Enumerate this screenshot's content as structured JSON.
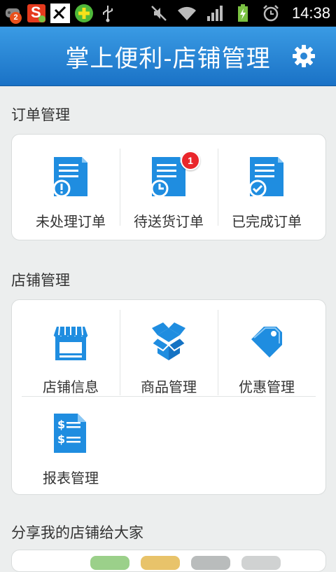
{
  "status_bar": {
    "time": "14:38",
    "notification_count": "2",
    "app_letter": "S"
  },
  "header": {
    "title": "掌上便利-店铺管理"
  },
  "orders": {
    "section_title": "订单管理",
    "items": [
      {
        "label": "未处理订单",
        "icon": "order-unprocessed-icon"
      },
      {
        "label": "待送货订单",
        "icon": "order-pending-delivery-icon",
        "badge": "1"
      },
      {
        "label": "已完成订单",
        "icon": "order-completed-icon"
      }
    ]
  },
  "store": {
    "section_title": "店铺管理",
    "items": [
      {
        "label": "店铺信息",
        "icon": "storefront-icon"
      },
      {
        "label": "商品管理",
        "icon": "box-icon"
      },
      {
        "label": "优惠管理",
        "icon": "tag-icon"
      },
      {
        "label": "报表管理",
        "icon": "report-icon"
      }
    ]
  },
  "share": {
    "section_title": "分享我的店铺给大家"
  },
  "colors": {
    "header_blue": "#1a72c6",
    "icon_blue": "#1f8de0",
    "badge_red": "#e9262b"
  }
}
